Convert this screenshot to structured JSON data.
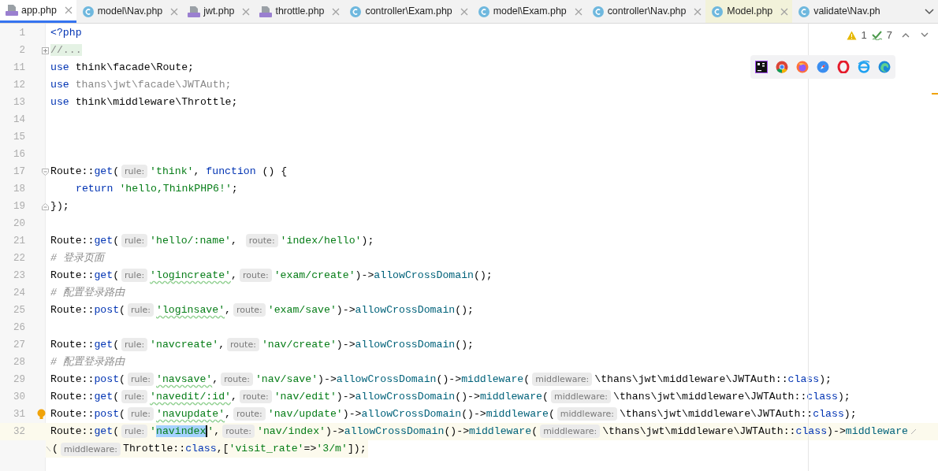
{
  "tabs": [
    {
      "label": "app.php",
      "kind": "php",
      "selected": true,
      "highlighted": false,
      "closable": true
    },
    {
      "label": "model\\Nav.php",
      "kind": "class",
      "selected": false,
      "highlighted": false,
      "closable": true
    },
    {
      "label": "jwt.php",
      "kind": "php",
      "selected": false,
      "highlighted": false,
      "closable": true
    },
    {
      "label": "throttle.php",
      "kind": "php",
      "selected": false,
      "highlighted": false,
      "closable": true
    },
    {
      "label": "controller\\Exam.php",
      "kind": "class",
      "selected": false,
      "highlighted": false,
      "closable": true
    },
    {
      "label": "model\\Exam.php",
      "kind": "class",
      "selected": false,
      "highlighted": false,
      "closable": true
    },
    {
      "label": "controller\\Nav.php",
      "kind": "class",
      "selected": false,
      "highlighted": false,
      "closable": true
    },
    {
      "label": "Model.php",
      "kind": "class",
      "selected": false,
      "highlighted": true,
      "closable": true
    },
    {
      "label": "validate\\Nav.ph",
      "kind": "class",
      "selected": false,
      "highlighted": false,
      "closable": false
    }
  ],
  "inspections": {
    "warnings": "1",
    "typos": "7"
  },
  "lines": [
    {
      "number": "1",
      "current": false,
      "kind": "plain",
      "tokens": [
        {
          "kind": "keyword",
          "text": "<?php"
        }
      ]
    },
    {
      "number": "2",
      "current": false,
      "kind": "folded",
      "tokens": [
        {
          "kind": "folded",
          "text": "//..."
        }
      ]
    },
    {
      "number": "11",
      "current": false,
      "kind": "plain",
      "tokens": [
        {
          "kind": "keyword",
          "text": "use"
        },
        {
          "kind": "plain",
          "text": " think\\facade\\Route;"
        }
      ]
    },
    {
      "number": "12",
      "current": false,
      "kind": "plain",
      "tokens": [
        {
          "kind": "keyword",
          "text": "use"
        },
        {
          "kind": "unused",
          "text": " thans\\jwt\\facade\\JWTAuth;"
        }
      ]
    },
    {
      "number": "13",
      "current": false,
      "kind": "plain",
      "tokens": [
        {
          "kind": "keyword",
          "text": "use"
        },
        {
          "kind": "plain",
          "text": " think\\middleware\\Throttle;"
        }
      ]
    },
    {
      "number": "14",
      "current": false,
      "kind": "plain"
    },
    {
      "number": "15",
      "current": false,
      "kind": "plain"
    },
    {
      "number": "16",
      "current": false,
      "kind": "plain"
    },
    {
      "number": "17",
      "current": false,
      "kind": "fold_start",
      "tokens": [
        {
          "kind": "plain",
          "text": "Route::"
        },
        {
          "kind": "call",
          "text": "get"
        },
        {
          "kind": "plain",
          "text": "("
        },
        {
          "kind": "hint",
          "text": "rule:"
        },
        {
          "kind": "string",
          "text": "'think'"
        },
        {
          "kind": "plain",
          "text": ", "
        },
        {
          "kind": "keyword",
          "text": "function"
        },
        {
          "kind": "plain",
          "text": " () {"
        }
      ]
    },
    {
      "number": "18",
      "current": false,
      "kind": "indented",
      "tokens": [
        {
          "kind": "keyword",
          "text": "return"
        },
        {
          "kind": "string",
          "text": " 'hello,ThinkPHP6!'"
        },
        {
          "kind": "plain",
          "text": ";"
        }
      ]
    },
    {
      "number": "19",
      "current": false,
      "kind": "fold_end",
      "tokens": [
        {
          "kind": "plain",
          "text": "});"
        }
      ]
    },
    {
      "number": "20",
      "current": false,
      "kind": "plain"
    },
    {
      "number": "21",
      "current": false,
      "kind": "plain",
      "tokens": [
        {
          "kind": "plain",
          "text": "Route::"
        },
        {
          "kind": "call",
          "text": "get"
        },
        {
          "kind": "plain",
          "text": "("
        },
        {
          "kind": "hint",
          "text": "rule:"
        },
        {
          "kind": "string",
          "text": "'hello/:name'"
        },
        {
          "kind": "plain",
          "text": ", "
        },
        {
          "kind": "hint",
          "text": "route:"
        },
        {
          "kind": "string",
          "text": "'index/hello'"
        },
        {
          "kind": "plain",
          "text": ");"
        }
      ]
    },
    {
      "number": "22",
      "current": false,
      "kind": "plain",
      "tokens": [
        {
          "kind": "comment",
          "text": "# 登录页面"
        }
      ]
    },
    {
      "number": "23",
      "current": false,
      "kind": "plain",
      "tokens": [
        {
          "kind": "plain",
          "text": "Route::"
        },
        {
          "kind": "call",
          "text": "get"
        },
        {
          "kind": "plain",
          "text": "("
        },
        {
          "kind": "hint",
          "text": "rule:"
        },
        {
          "kind": "string",
          "text": "'logincreate'",
          "typo": true
        },
        {
          "kind": "plain",
          "text": ","
        },
        {
          "kind": "hint",
          "text": "route:"
        },
        {
          "kind": "string",
          "text": "'exam/create'"
        },
        {
          "kind": "plain",
          "text": ")->"
        },
        {
          "kind": "method",
          "text": "allowCrossDomain"
        },
        {
          "kind": "plain",
          "text": "();"
        }
      ]
    },
    {
      "number": "24",
      "current": false,
      "kind": "plain",
      "tokens": [
        {
          "kind": "comment",
          "text": "# 配置登录路由"
        }
      ]
    },
    {
      "number": "25",
      "current": false,
      "kind": "plain",
      "tokens": [
        {
          "kind": "plain",
          "text": "Route::"
        },
        {
          "kind": "call",
          "text": "post"
        },
        {
          "kind": "plain",
          "text": "("
        },
        {
          "kind": "hint",
          "text": "rule:"
        },
        {
          "kind": "string",
          "text": "'loginsave'",
          "typo": true
        },
        {
          "kind": "plain",
          "text": ","
        },
        {
          "kind": "hint",
          "text": "route:"
        },
        {
          "kind": "string",
          "text": "'exam/save'"
        },
        {
          "kind": "plain",
          "text": ")->"
        },
        {
          "kind": "method",
          "text": "allowCrossDomain"
        },
        {
          "kind": "plain",
          "text": "();"
        }
      ]
    },
    {
      "number": "26",
      "current": false,
      "kind": "plain"
    },
    {
      "number": "27",
      "current": false,
      "kind": "plain",
      "tokens": [
        {
          "kind": "plain",
          "text": "Route::"
        },
        {
          "kind": "call",
          "text": "get"
        },
        {
          "kind": "plain",
          "text": "("
        },
        {
          "kind": "hint",
          "text": "rule:"
        },
        {
          "kind": "string",
          "text": "'navcreate'"
        },
        {
          "kind": "plain",
          "text": ","
        },
        {
          "kind": "hint",
          "text": "route:"
        },
        {
          "kind": "string",
          "text": "'nav/create'"
        },
        {
          "kind": "plain",
          "text": ")->"
        },
        {
          "kind": "method",
          "text": "allowCrossDomain"
        },
        {
          "kind": "plain",
          "text": "();"
        }
      ]
    },
    {
      "number": "28",
      "current": false,
      "kind": "plain",
      "tokens": [
        {
          "kind": "comment",
          "text": "# 配置登录路由"
        }
      ]
    },
    {
      "number": "29",
      "current": false,
      "kind": "plain",
      "tokens": [
        {
          "kind": "plain",
          "text": "Route::"
        },
        {
          "kind": "call",
          "text": "post"
        },
        {
          "kind": "plain",
          "text": "("
        },
        {
          "kind": "hint",
          "text": "rule:"
        },
        {
          "kind": "string",
          "text": "'navsave'",
          "typo": true
        },
        {
          "kind": "plain",
          "text": ","
        },
        {
          "kind": "hint",
          "text": "route:"
        },
        {
          "kind": "string",
          "text": "'nav/save'"
        },
        {
          "kind": "plain",
          "text": ")->"
        },
        {
          "kind": "method",
          "text": "allowCrossDomain"
        },
        {
          "kind": "plain",
          "text": "()->"
        },
        {
          "kind": "method",
          "text": "middleware"
        },
        {
          "kind": "plain",
          "text": "("
        },
        {
          "kind": "hint",
          "text": "middleware:"
        },
        {
          "kind": "plain",
          "text": "\\thans\\jwt\\middleware\\JWTAuth::"
        },
        {
          "kind": "keyword",
          "text": "class"
        },
        {
          "kind": "plain",
          "text": ");"
        }
      ]
    },
    {
      "number": "30",
      "current": false,
      "kind": "plain",
      "tokens": [
        {
          "kind": "plain",
          "text": "Route::"
        },
        {
          "kind": "call",
          "text": "get"
        },
        {
          "kind": "plain",
          "text": "("
        },
        {
          "kind": "hint",
          "text": "rule:"
        },
        {
          "kind": "string",
          "text": "'navedit/:id'",
          "typo": true
        },
        {
          "kind": "plain",
          "text": ","
        },
        {
          "kind": "hint",
          "text": "route:"
        },
        {
          "kind": "string",
          "text": "'nav/edit'"
        },
        {
          "kind": "plain",
          "text": ")->"
        },
        {
          "kind": "method",
          "text": "allowCrossDomain"
        },
        {
          "kind": "plain",
          "text": "()->"
        },
        {
          "kind": "method",
          "text": "middleware"
        },
        {
          "kind": "plain",
          "text": "("
        },
        {
          "kind": "hint",
          "text": "middleware:"
        },
        {
          "kind": "plain",
          "text": "\\thans\\jwt\\middleware\\JWTAuth::"
        },
        {
          "kind": "keyword",
          "text": "class"
        },
        {
          "kind": "plain",
          "text": ");"
        }
      ]
    },
    {
      "number": "31",
      "current": false,
      "kind": "plain",
      "tokens": [
        {
          "kind": "plain",
          "text": "Route::"
        },
        {
          "kind": "call",
          "text": "post"
        },
        {
          "kind": "plain",
          "text": "("
        },
        {
          "kind": "hint",
          "text": "rule:"
        },
        {
          "kind": "string",
          "text": "'navupdate'",
          "typo": true
        },
        {
          "kind": "plain",
          "text": ","
        },
        {
          "kind": "hint",
          "text": "route:"
        },
        {
          "kind": "string",
          "text": "'nav/update'"
        },
        {
          "kind": "plain",
          "text": ")->"
        },
        {
          "kind": "method",
          "text": "allowCrossDomain"
        },
        {
          "kind": "plain",
          "text": "()->"
        },
        {
          "kind": "method",
          "text": "middleware"
        },
        {
          "kind": "plain",
          "text": "("
        },
        {
          "kind": "hint",
          "text": "middleware:"
        },
        {
          "kind": "plain",
          "text": "\\thans\\jwt\\middleware\\JWTAuth::"
        },
        {
          "kind": "keyword",
          "text": "class"
        },
        {
          "kind": "plain",
          "text": ");"
        }
      ]
    },
    {
      "number": "32",
      "current": true,
      "kind": "plain",
      "tokens": [
        {
          "kind": "plain",
          "text": "Route::"
        },
        {
          "kind": "call",
          "text": "get"
        },
        {
          "kind": "plain",
          "text": "("
        },
        {
          "kind": "hint",
          "text": "rule:"
        },
        {
          "kind": "string",
          "text": "'"
        },
        {
          "kind": "string",
          "text": "navindex",
          "selected": true
        },
        {
          "kind": "string",
          "text": "'"
        },
        {
          "kind": "plain",
          "text": ","
        },
        {
          "kind": "hint",
          "text": "route:"
        },
        {
          "kind": "string",
          "text": "'nav/index'"
        },
        {
          "kind": "plain",
          "text": ")->"
        },
        {
          "kind": "method",
          "text": "allowCrossDomain"
        },
        {
          "kind": "plain",
          "text": "()->"
        },
        {
          "kind": "method",
          "text": "middleware"
        },
        {
          "kind": "plain",
          "text": "("
        },
        {
          "kind": "hint",
          "text": "middleware:"
        },
        {
          "kind": "plain",
          "text": "\\thans\\jwt\\middleware\\JWTAuth::"
        },
        {
          "kind": "keyword",
          "text": "class"
        },
        {
          "kind": "plain",
          "text": ")->"
        },
        {
          "kind": "method",
          "text": "middleware"
        }
      ],
      "wrapped": [
        {
          "kind": "plain",
          "text": "("
        },
        {
          "kind": "hint",
          "text": "middleware:"
        },
        {
          "kind": "plain",
          "text": "Throttle::"
        },
        {
          "kind": "keyword",
          "text": "class"
        },
        {
          "kind": "plain",
          "text": ",["
        },
        {
          "kind": "string",
          "text": "'visit_rate'"
        },
        {
          "kind": "plain",
          "text": "=>"
        },
        {
          "kind": "string",
          "text": "'3/m'"
        },
        {
          "kind": "plain",
          "text": "]);"
        }
      ]
    }
  ]
}
